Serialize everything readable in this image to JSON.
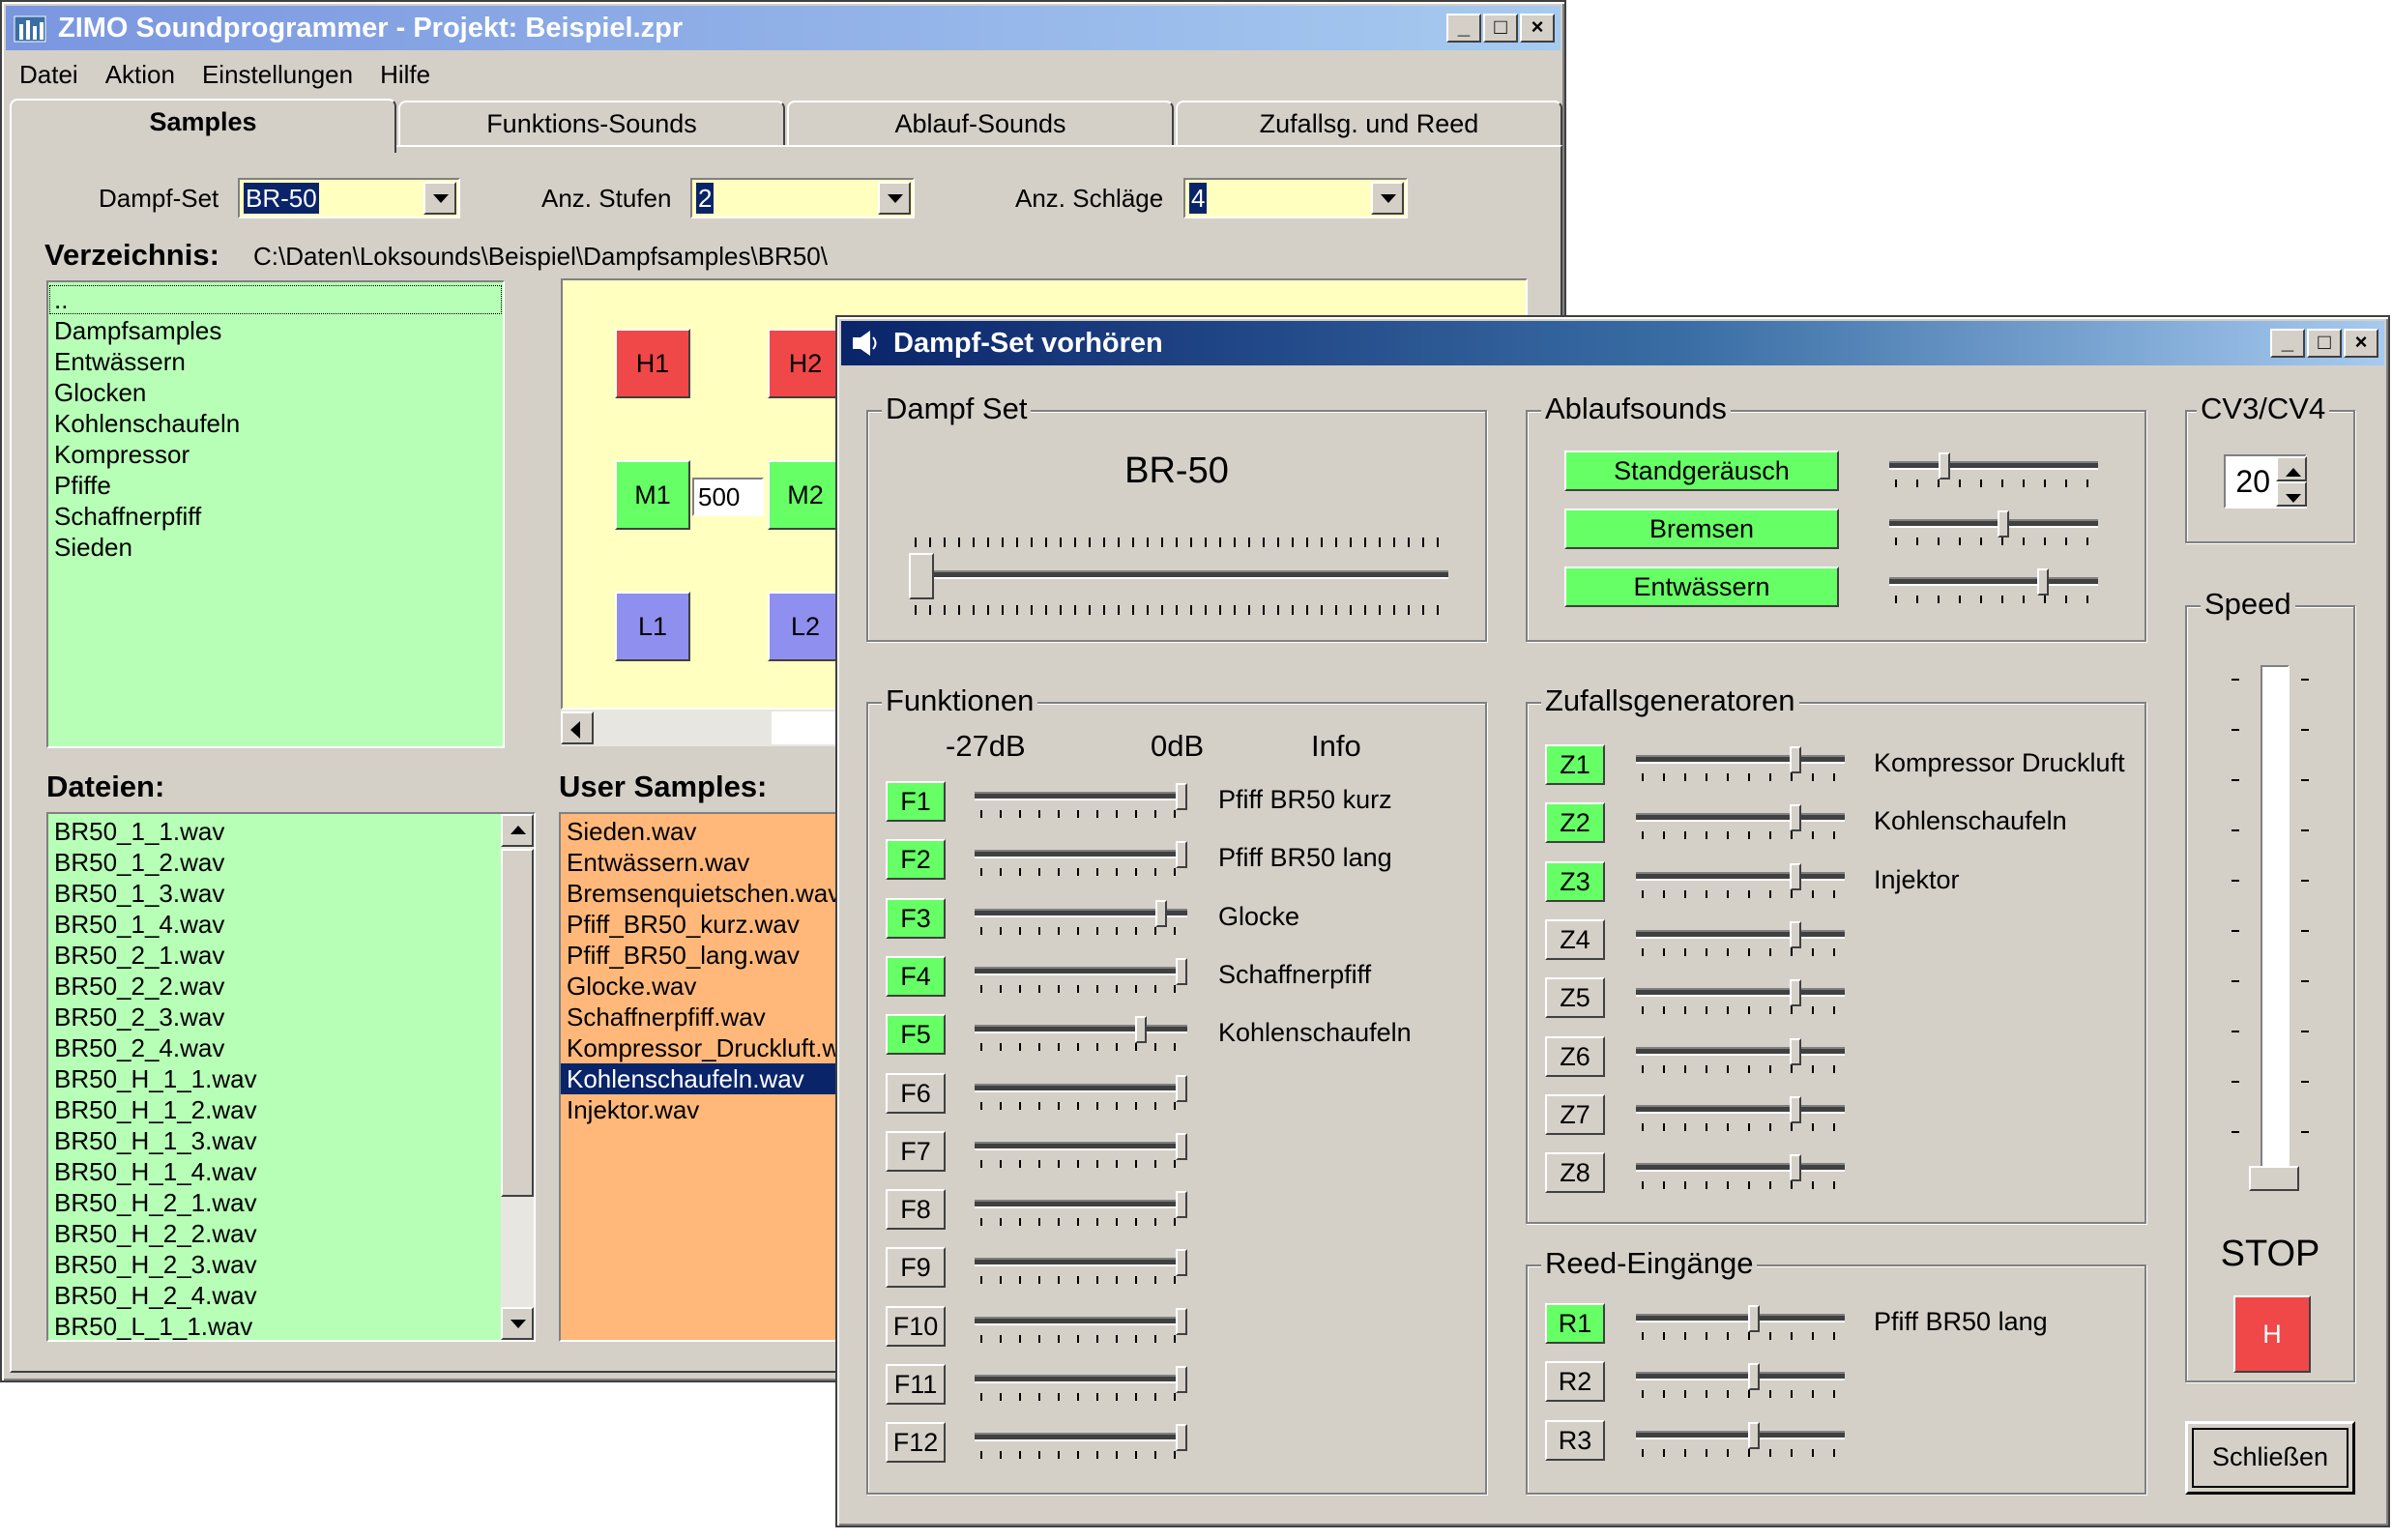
{
  "main": {
    "title": "ZIMO Soundprogrammer - Projekt: Beispiel.zpr",
    "menu": [
      "Datei",
      "Aktion",
      "Einstellungen",
      "Hilfe"
    ],
    "tabs": [
      "Samples",
      "Funktions-Sounds",
      "Ablauf-Sounds",
      "Zufallsg. und Reed"
    ],
    "dampfset_label": "Dampf-Set",
    "dampfset_value": "BR-50",
    "stufen_label": "Anz. Stufen",
    "stufen_value": "2",
    "schlaege_label": "Anz. Schläge",
    "schlaege_value": "4",
    "verzeichnis_label": "Verzeichnis:",
    "verzeichnis_path": "C:\\Daten\\Loksounds\\Beispiel\\Dampfsamples\\BR50\\",
    "folders": [
      "..",
      "Dampfsamples",
      "Entwässern",
      "Glocken",
      "Kohlenschaufeln",
      "Kompressor",
      "Pfiffe",
      "Schaffnerpfiff",
      "Sieden"
    ],
    "dateien_label": "Dateien:",
    "files": [
      "BR50_1_1.wav",
      "BR50_1_2.wav",
      "BR50_1_3.wav",
      "BR50_1_4.wav",
      "BR50_2_1.wav",
      "BR50_2_2.wav",
      "BR50_2_3.wav",
      "BR50_2_4.wav",
      "BR50_H_1_1.wav",
      "BR50_H_1_2.wav",
      "BR50_H_1_3.wav",
      "BR50_H_1_4.wav",
      "BR50_H_2_1.wav",
      "BR50_H_2_2.wav",
      "BR50_H_2_3.wav",
      "BR50_H_2_4.wav",
      "BR50_L_1_1.wav"
    ],
    "user_samples_label": "User Samples:",
    "user_samples": [
      "Sieden.wav",
      "Entwässern.wav",
      "Bremsenquietschen.wav",
      "Pfiff_BR50_kurz.wav",
      "Pfiff_BR50_lang.wav",
      "Glocke.wav",
      "Schaffnerpfiff.wav",
      "Kompressor_Druckluft.wav",
      "Kohlenschaufeln.wav",
      "Injektor.wav"
    ],
    "user_selected": "Kohlenschaufeln.wav",
    "pads": {
      "h1": "H1",
      "h2": "H2",
      "m1": "M1",
      "m2": "M2",
      "l1": "L1",
      "l2": "L2",
      "between": "500"
    }
  },
  "dialog": {
    "title": "Dampf-Set vorhören",
    "dampfset_group": "Dampf Set",
    "dampfset_name": "BR-50",
    "dampfset_slider": 0.0,
    "ablauf_group": "Ablaufsounds",
    "ablauf": [
      {
        "label": "Standgeräusch",
        "level": 0.25
      },
      {
        "label": "Bremsen",
        "level": 0.55
      },
      {
        "label": "Entwässern",
        "level": 0.75
      }
    ],
    "cv_group": "CV3/CV4",
    "cv_value": "20",
    "speed_group": "Speed",
    "stop_label": "STOP",
    "h_label": "H",
    "funktionen_group": "Funktionen",
    "col_min": "-27dB",
    "col_max": "0dB",
    "col_info": "Info",
    "funktionen": [
      {
        "label": "F1",
        "active": true,
        "info": "Pfiff BR50 kurz",
        "level": 1.0
      },
      {
        "label": "F2",
        "active": true,
        "info": "Pfiff BR50 lang",
        "level": 1.0
      },
      {
        "label": "F3",
        "active": true,
        "info": "Glocke",
        "level": 0.9
      },
      {
        "label": "F4",
        "active": true,
        "info": "Schaffnerpfiff",
        "level": 1.0
      },
      {
        "label": "F5",
        "active": true,
        "info": "Kohlenschaufeln",
        "level": 0.8
      },
      {
        "label": "F6",
        "active": false,
        "info": "",
        "level": 1.0
      },
      {
        "label": "F7",
        "active": false,
        "info": "",
        "level": 1.0
      },
      {
        "label": "F8",
        "active": false,
        "info": "",
        "level": 1.0
      },
      {
        "label": "F9",
        "active": false,
        "info": "",
        "level": 1.0
      },
      {
        "label": "F10",
        "active": false,
        "info": "",
        "level": 1.0
      },
      {
        "label": "F11",
        "active": false,
        "info": "",
        "level": 1.0
      },
      {
        "label": "F12",
        "active": false,
        "info": "",
        "level": 1.0
      }
    ],
    "zufall_group": "Zufallsgeneratoren",
    "zufall": [
      {
        "label": "Z1",
        "active": true,
        "info": "Kompressor Druckluft",
        "level": 0.78
      },
      {
        "label": "Z2",
        "active": true,
        "info": "Kohlenschaufeln",
        "level": 0.78
      },
      {
        "label": "Z3",
        "active": true,
        "info": "Injektor",
        "level": 0.78
      },
      {
        "label": "Z4",
        "active": false,
        "info": "",
        "level": 0.78
      },
      {
        "label": "Z5",
        "active": false,
        "info": "",
        "level": 0.78
      },
      {
        "label": "Z6",
        "active": false,
        "info": "",
        "level": 0.78
      },
      {
        "label": "Z7",
        "active": false,
        "info": "",
        "level": 0.78
      },
      {
        "label": "Z8",
        "active": false,
        "info": "",
        "level": 0.78
      }
    ],
    "reed_group": "Reed-Eingänge",
    "reed": [
      {
        "label": "R1",
        "active": true,
        "info": "Pfiff BR50 lang",
        "level": 0.57
      },
      {
        "label": "R2",
        "active": false,
        "info": "",
        "level": 0.57
      },
      {
        "label": "R3",
        "active": false,
        "info": "",
        "level": 0.57
      }
    ],
    "close_label": "Schließen"
  }
}
